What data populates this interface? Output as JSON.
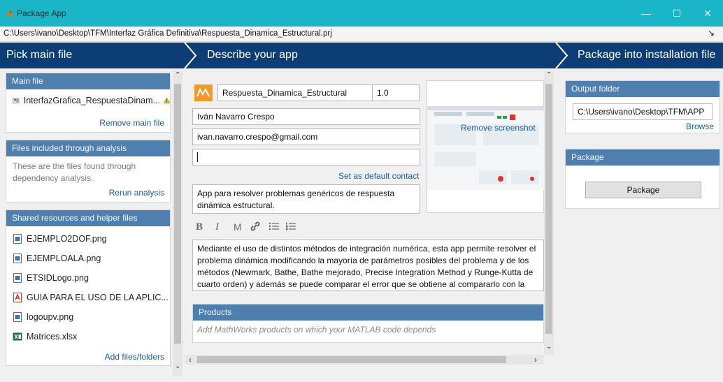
{
  "window": {
    "title": "Package App",
    "project_path": "C:\\Users\\ivano\\Desktop\\TFM\\Interfaz Gráfica Definitiva\\Respuesta_Dinamica_Estructural.prj",
    "minimize": "—",
    "maximize": "☐",
    "close": "✕"
  },
  "steps": [
    {
      "label": "Pick main file"
    },
    {
      "label": "Describe your app"
    },
    {
      "label": "Package into installation file"
    }
  ],
  "left": {
    "main_file": {
      "header": "Main file",
      "file_name": "InterfazGrafica_RespuestaDinam...",
      "remove_link": "Remove main file"
    },
    "analysis": {
      "header": "Files included through analysis",
      "description": "These are the files found through dependency analysis.",
      "rerun_link": "Rerun analysis"
    },
    "shared": {
      "header": "Shared resources and helper files",
      "files": [
        {
          "name": "EJEMPLO2DOF.png",
          "icon": "image-file-icon"
        },
        {
          "name": "EJEMPLOALA.png",
          "icon": "image-file-icon"
        },
        {
          "name": "ETSIDLogo.png",
          "icon": "image-file-icon"
        },
        {
          "name": "GUIA PARA EL USO DE LA APLIC...",
          "icon": "pdf-file-icon"
        },
        {
          "name": "logoupv.png",
          "icon": "image-file-icon"
        },
        {
          "name": "Matrices.xlsx",
          "icon": "excel-file-icon"
        }
      ],
      "add_link": "Add files/folders"
    }
  },
  "describe": {
    "app_name": "Respuesta_Dinamica_Estructural",
    "version": "1.0",
    "author_name": "Iván Navarro Crespo",
    "email": "ivan.navarro.crespo@gmail.com",
    "company": "",
    "default_contact_link": "Set as default contact",
    "summary": "App para resolver problemas genéricos de respuesta dinámica estructural.",
    "description": "Mediante el uso de distintos métodos de integración numérica, esta app permite resolver  el problema dinámica modificando la mayoría de parámetros  posibles del problema y de los métodos (Newmark, Bathe, Bathe mejorado, Precise Integration Method y Runge-Kutta de cuarto orden) y además se puede comparar el error que se obtiene al compararlo con la",
    "remove_screenshot_link": "Remove screenshot",
    "toolbar": {
      "bold": "B",
      "italic": "I",
      "monospace": "M",
      "link": "🔗",
      "bullets": "☰",
      "numbered": "☷"
    },
    "products": {
      "header": "Products",
      "placeholder": "Add MathWorks products on which your MATLAB code depends"
    }
  },
  "right": {
    "output": {
      "header": "Output folder",
      "path": "C:\\Users\\ivano\\Desktop\\TFM\\APP",
      "browse_link": "Browse"
    },
    "package": {
      "header": "Package",
      "button": "Package"
    }
  },
  "colors": {
    "titlebar": "#1ab6c8",
    "steps_bar": "#0c3e75",
    "section_header": "#4f7fae",
    "link": "#1b5ea7"
  }
}
